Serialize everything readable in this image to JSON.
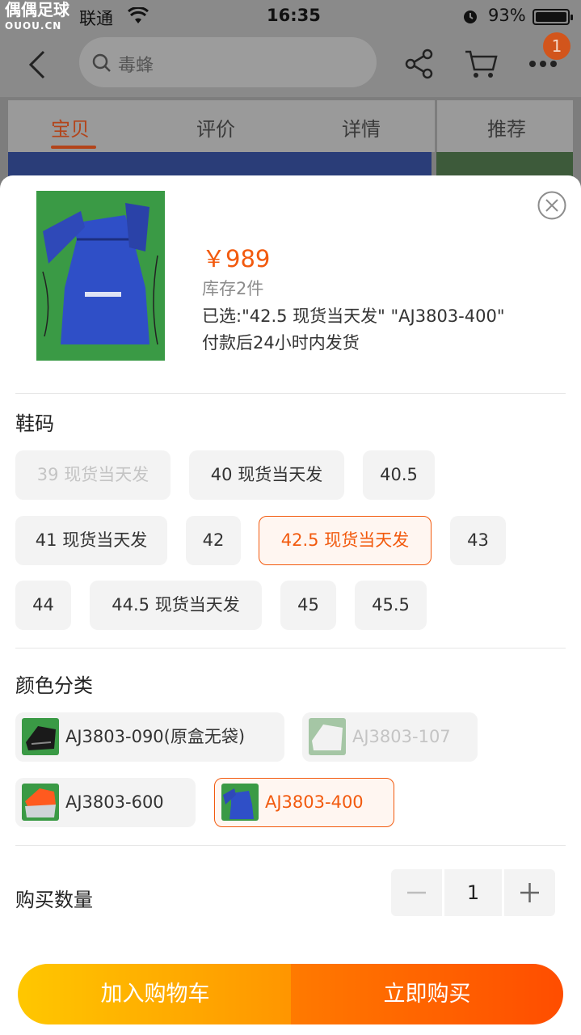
{
  "status_bar": {
    "watermark": "偶偶足球",
    "watermark_sub": "OUOU.CN",
    "carrier": "联通",
    "time": "16:35",
    "battery": "93%"
  },
  "nav": {
    "search_placeholder": "毒蜂",
    "cart_badge": "1"
  },
  "tabs": [
    {
      "label": "宝贝",
      "active": true
    },
    {
      "label": "评价"
    },
    {
      "label": "详情"
    },
    {
      "label": "推荐"
    }
  ],
  "product": {
    "price": "￥989",
    "stock": "库存2件",
    "selected": "已选:\"42.5 现货当天发\" \"AJ3803-400\"",
    "shipping": "付款后24小时内发货"
  },
  "size_section": {
    "title": "鞋码",
    "options": [
      {
        "label": "39 现货当天发",
        "state": "disabled"
      },
      {
        "label": "40 现货当天发",
        "state": "normal"
      },
      {
        "label": "40.5",
        "state": "normal"
      },
      {
        "label": "41 现货当天发",
        "state": "normal"
      },
      {
        "label": "42",
        "state": "normal"
      },
      {
        "label": "42.5 现货当天发",
        "state": "selected"
      },
      {
        "label": "43",
        "state": "normal"
      },
      {
        "label": "44",
        "state": "normal"
      },
      {
        "label": "44.5 现货当天发",
        "state": "normal"
      },
      {
        "label": "45",
        "state": "normal"
      },
      {
        "label": "45.5",
        "state": "normal"
      }
    ]
  },
  "color_section": {
    "title": "颜色分类",
    "options": [
      {
        "label": "AJ3803-090(原盒无袋)",
        "state": "normal"
      },
      {
        "label": "AJ3803-107",
        "state": "disabled"
      },
      {
        "label": "AJ3803-600",
        "state": "normal"
      },
      {
        "label": "AJ3803-400",
        "state": "selected"
      }
    ]
  },
  "quantity": {
    "label": "购买数量",
    "value": "1"
  },
  "actions": {
    "add_to_cart": "加入购物车",
    "buy_now": "立即购买"
  },
  "colors": {
    "accent": "#f25a0e",
    "cart_gradient": [
      "#ffc700",
      "#ff9500"
    ],
    "buy_gradient": [
      "#ff7a00",
      "#ff4d00"
    ]
  }
}
